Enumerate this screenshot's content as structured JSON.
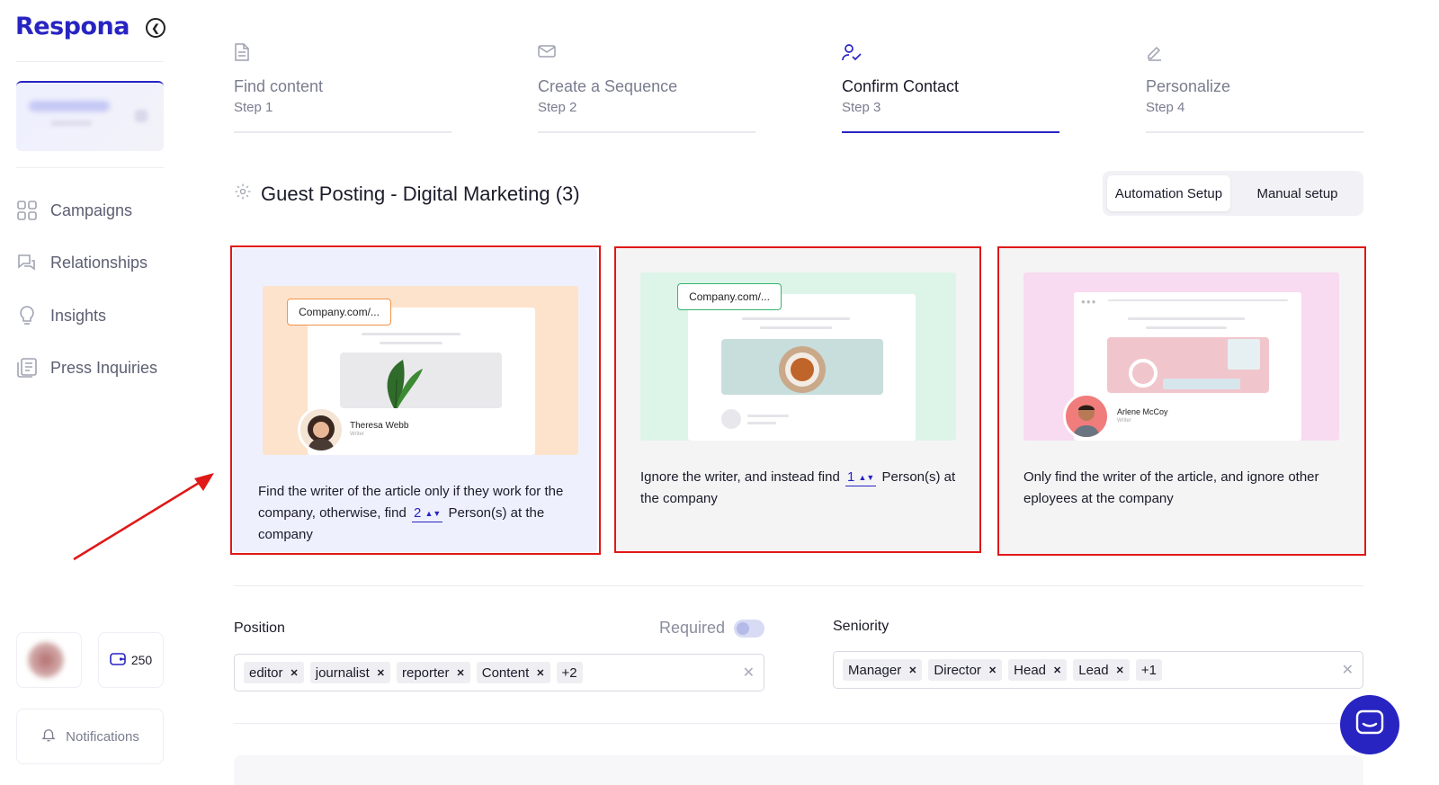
{
  "app": {
    "logo": "Respona"
  },
  "sidebar": {
    "nav": [
      {
        "label": "Campaigns",
        "icon": "grid-icon"
      },
      {
        "label": "Relationships",
        "icon": "chat-bubbles-icon"
      },
      {
        "label": "Insights",
        "icon": "lightbulb-icon"
      },
      {
        "label": "Press Inquiries",
        "icon": "newspaper-icon"
      }
    ],
    "credits": "250",
    "notifications_label": "Notifications"
  },
  "stepper": [
    {
      "title": "Find content",
      "sub": "Step 1",
      "icon": "document-icon"
    },
    {
      "title": "Create a Sequence",
      "sub": "Step 2",
      "icon": "envelope-icon"
    },
    {
      "title": "Confirm Contact",
      "sub": "Step 3",
      "icon": "user-check-icon",
      "active": true
    },
    {
      "title": "Personalize",
      "sub": "Step 4",
      "icon": "pencil-icon"
    }
  ],
  "campaign": {
    "title": "Guest Posting - Digital Marketing (3)"
  },
  "setup_toggle": {
    "automation": "Automation Setup",
    "manual": "Manual setup",
    "selected": "automation"
  },
  "options": [
    {
      "url_tag": "Company.com/...",
      "person_name": "Theresa Webb",
      "person_role": "Writer",
      "text_before": "Find the writer of the article only if they work for the company, otherwise, find",
      "number": "2",
      "text_after": "Person(s) at the company",
      "selected": true
    },
    {
      "url_tag": "Company.com/...",
      "text_before": "Ignore the writer, and instead find",
      "number": "1",
      "text_after": "Person(s) at the company"
    },
    {
      "person_name": "Arlene McCoy",
      "person_role": "Writer",
      "text": "Only find the writer of the article, and ignore other eployees at the company"
    }
  ],
  "position": {
    "label": "Position",
    "required_label": "Required",
    "required": false,
    "chips": [
      "editor",
      "journalist",
      "reporter",
      "Content"
    ],
    "more": "+2"
  },
  "seniority": {
    "label": "Seniority",
    "chips": [
      "Manager",
      "Director",
      "Head",
      "Lead"
    ],
    "more": "+1"
  },
  "colors": {
    "accent": "#2824c2",
    "highlight": "#e01818"
  }
}
